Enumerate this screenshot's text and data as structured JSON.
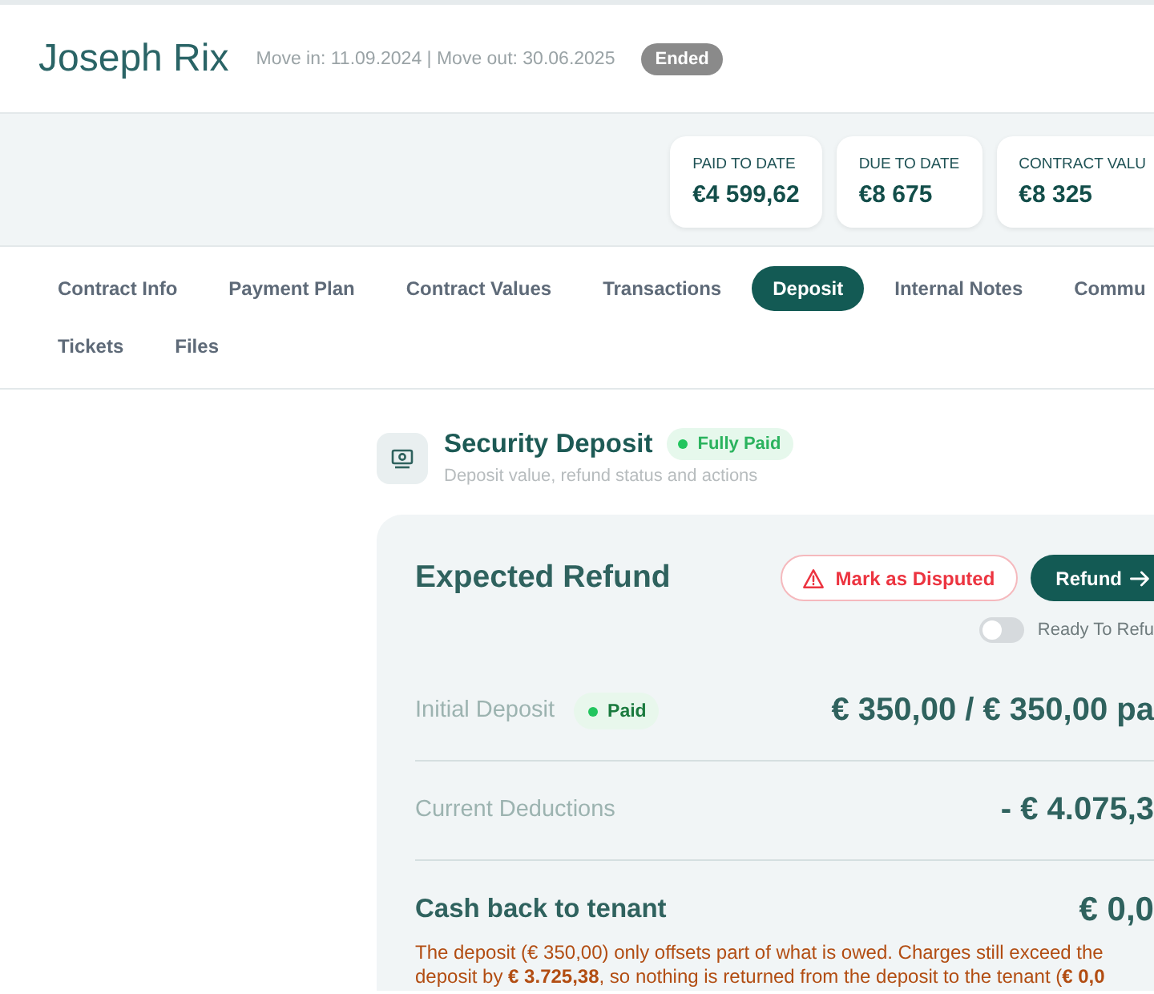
{
  "header": {
    "name": "Joseph Rix",
    "dates": "Move in: 11.09.2024 | Move out: 30.06.2025",
    "status": "Ended"
  },
  "stats": [
    {
      "label": "PAID TO DATE",
      "value": "€4 599,62"
    },
    {
      "label": "DUE TO DATE",
      "value": "€8 675"
    },
    {
      "label": "CONTRACT VALU",
      "value": "€8 325"
    }
  ],
  "tabs": [
    [
      {
        "label": "Contract Info",
        "selected": false
      },
      {
        "label": "Payment Plan",
        "selected": false
      },
      {
        "label": "Contract Values",
        "selected": false
      },
      {
        "label": "Transactions",
        "selected": false
      },
      {
        "label": "Deposit",
        "selected": true
      },
      {
        "label": "Internal Notes",
        "selected": false
      },
      {
        "label": "Commu",
        "selected": false
      }
    ],
    [
      {
        "label": "Tickets",
        "selected": false
      },
      {
        "label": "Files",
        "selected": false
      }
    ]
  ],
  "deposit": {
    "title": "Security Deposit",
    "status": "Fully Paid",
    "subtitle": "Deposit value, refund status and actions",
    "card": {
      "title": "Expected Refund",
      "actions": [
        {
          "kind": "outline",
          "label": "Mark as Disputed"
        },
        {
          "kind": "primary",
          "label": "Refund"
        }
      ],
      "toggle": {
        "label": "Ready To Refu",
        "on": false
      },
      "rows": [
        {
          "kind": "line",
          "label": "Initial Deposit",
          "badge": "Paid",
          "value": "€ 350,00 / € 350,00 pa"
        },
        {
          "kind": "line",
          "label": "Current Deductions",
          "value": "- € 4.075,3"
        },
        {
          "kind": "total",
          "label": "Cash back to tenant",
          "value": "€ 0,0"
        }
      ],
      "note": "The deposit (€ 350,00) only offsets part of what is owed. Charges still exceed the\ndeposit by **€ 3.725,38**, so nothing is returned from the deposit to the tenant (**€ 0,0**"
    }
  }
}
